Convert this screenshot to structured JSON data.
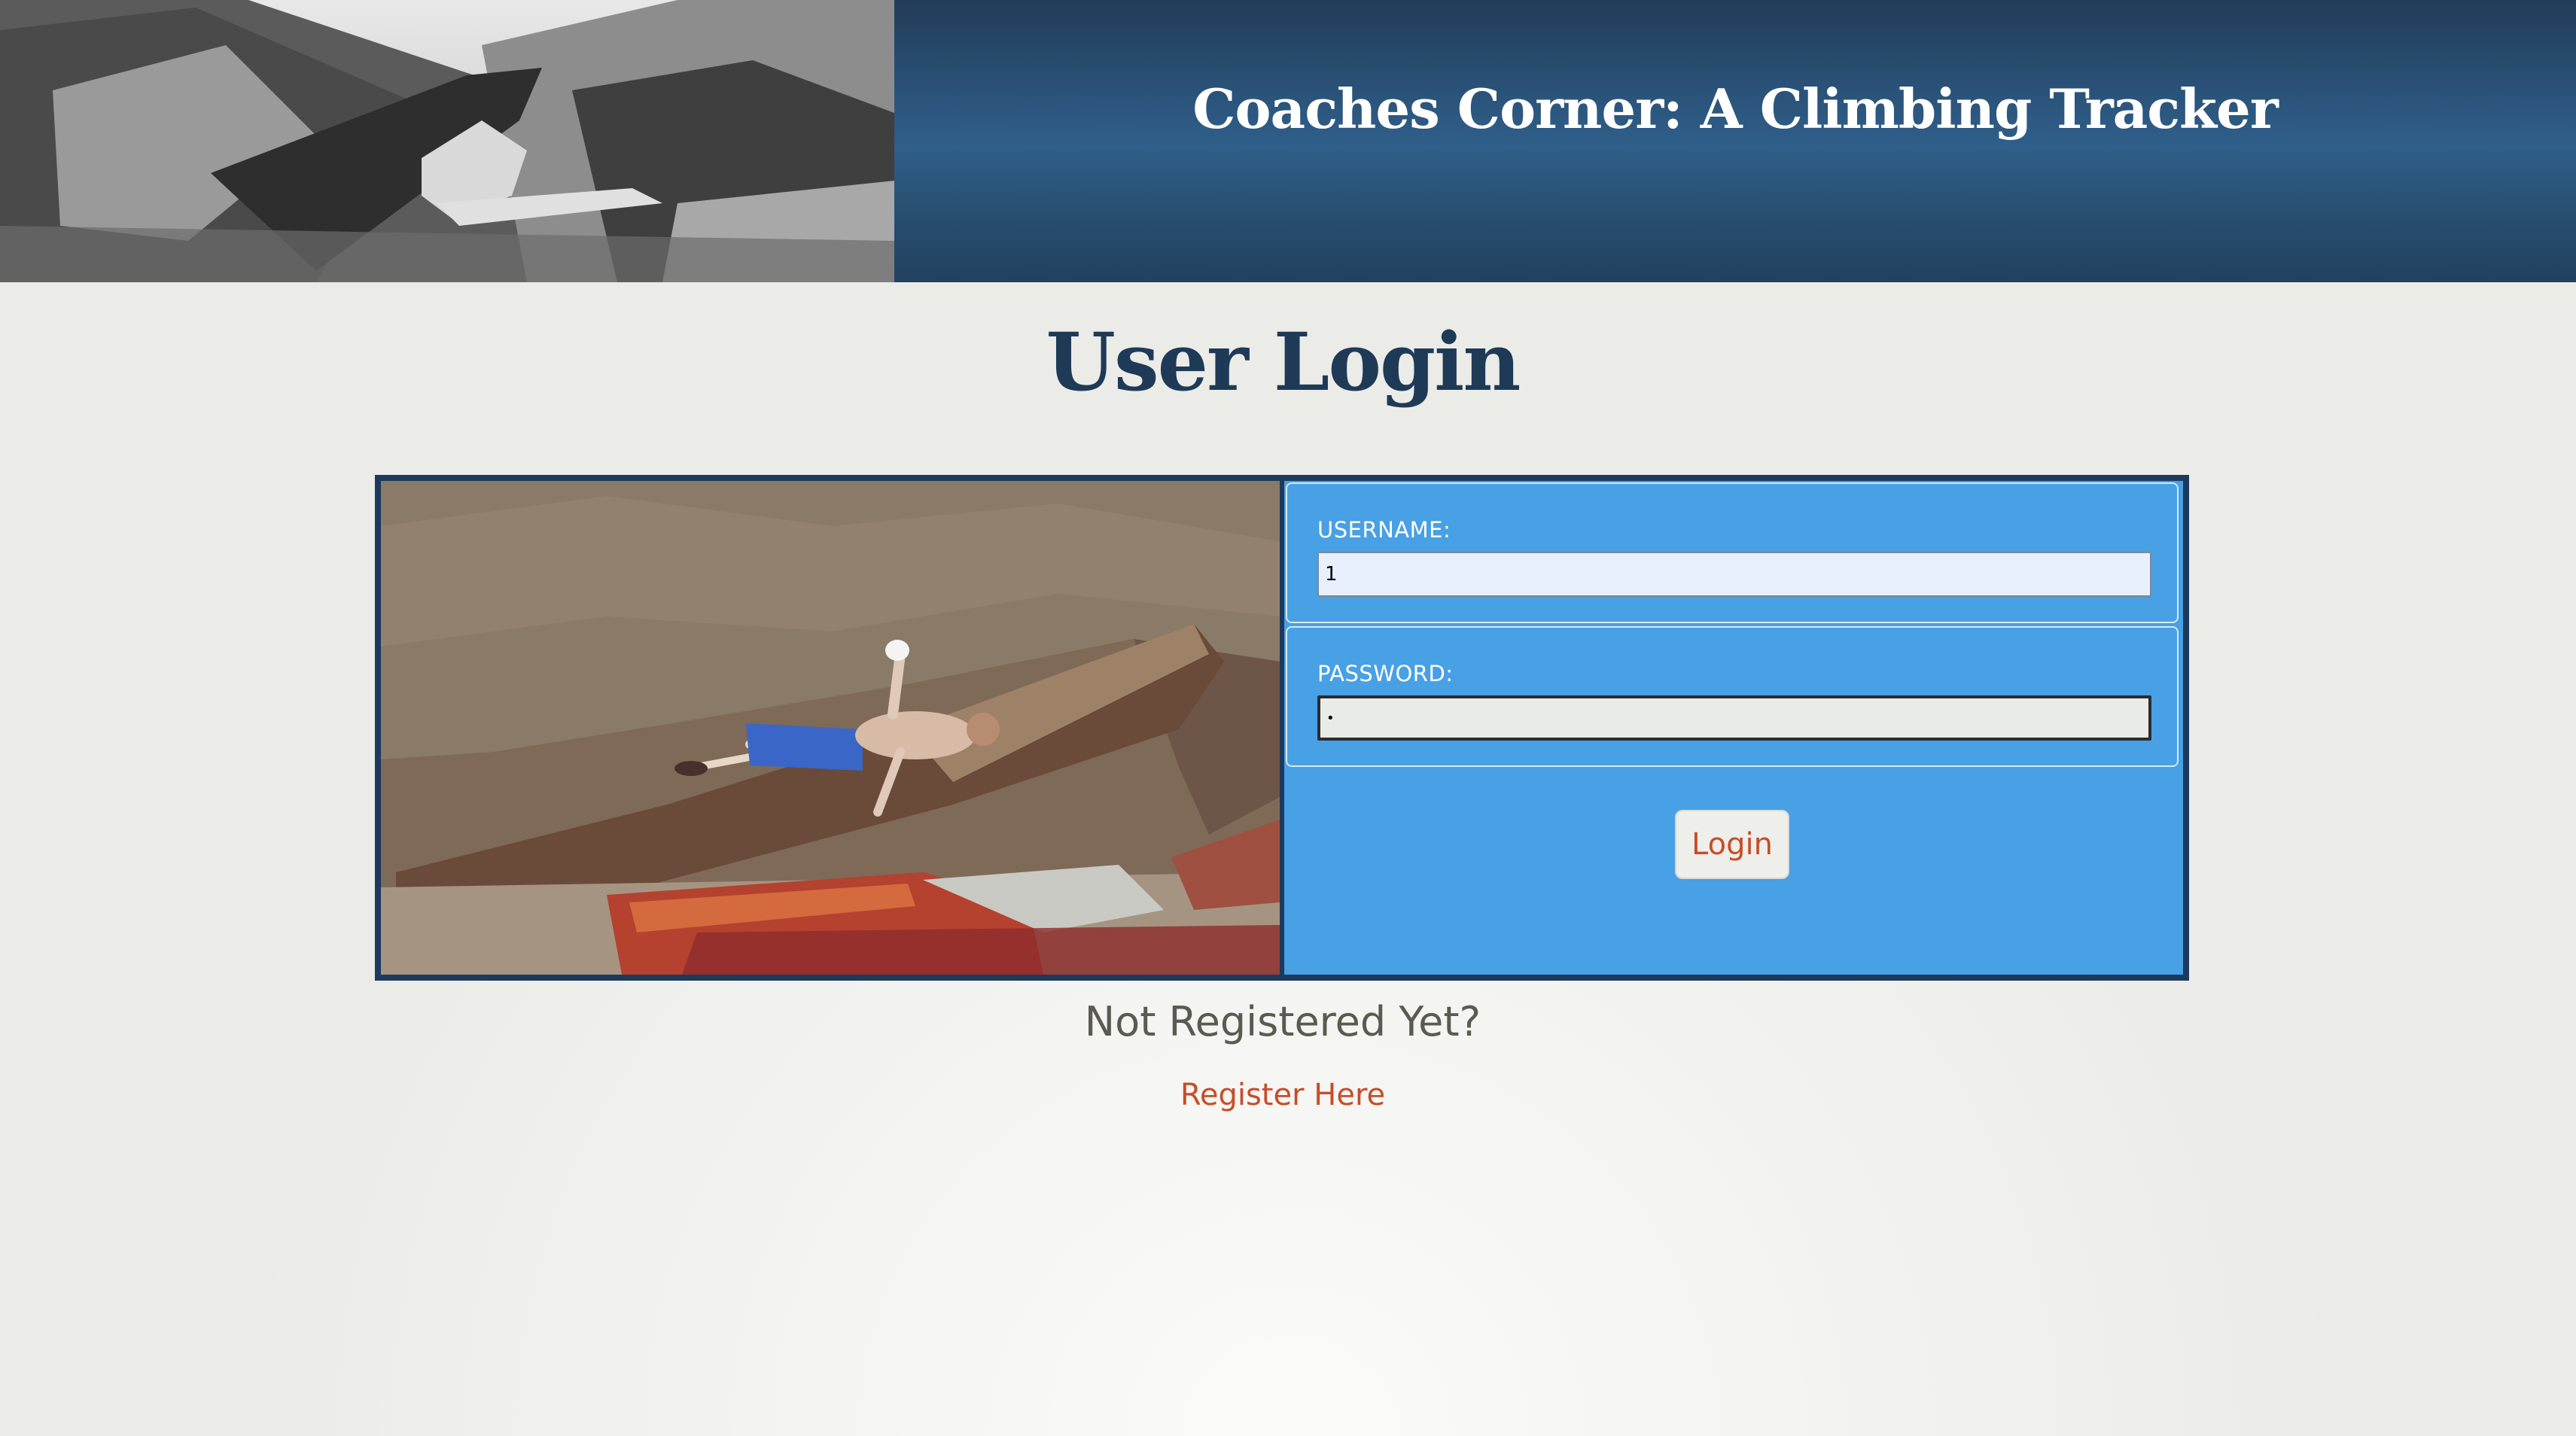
{
  "header": {
    "title": "Coaches Corner: A Climbing Tracker"
  },
  "page": {
    "heading": "User Login"
  },
  "login_form": {
    "username_label": "USERNAME:",
    "username_value": "1",
    "password_label": "PASSWORD:",
    "password_value": "•",
    "submit_label": "Login"
  },
  "register": {
    "prompt": "Not Registered Yet?",
    "link_label": "Register Here"
  },
  "colors": {
    "header_blue": "#2a5177",
    "heading_navy": "#1f3a57",
    "form_blue": "#48a0e5",
    "link_orange": "#c74d28"
  }
}
